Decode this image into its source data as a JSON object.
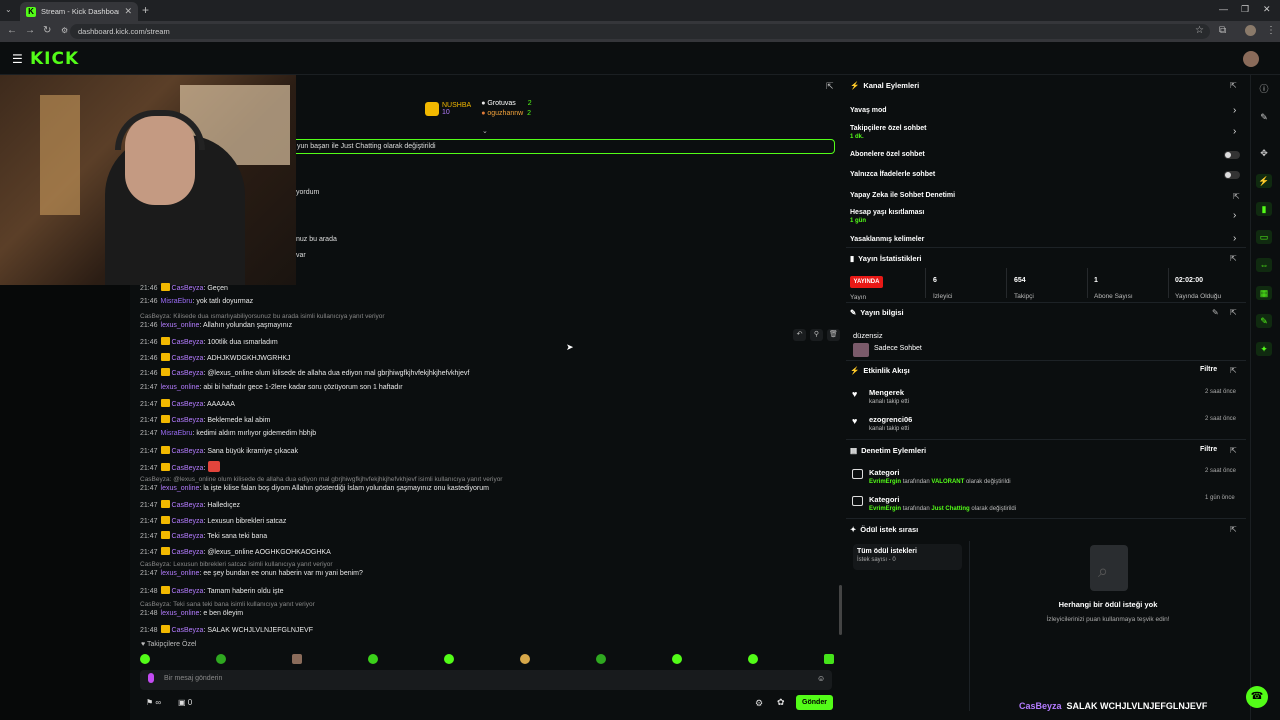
{
  "browser": {
    "tab_title": "Stream - Kick Dashboard",
    "url": "dashboard.kick.com/stream"
  },
  "header": {
    "logo": "KICK"
  },
  "leaderboard": {
    "first": {
      "name": "NUSHBA",
      "value": "10"
    },
    "second": {
      "name": "Grotuvas",
      "value": "2"
    },
    "third": {
      "name": "oguzhannw",
      "value": "2"
    }
  },
  "pinned_text": "yun başarı ile Just Chatting olarak değiştirildi",
  "ghost_lines": [
    "yordum",
    "nuz bu arada",
    "var"
  ],
  "messages": [
    {
      "time": "21:46",
      "user": "CasBeyza",
      "text": ": Geçen",
      "badge": true
    },
    {
      "time": "21:46",
      "user": "MisraEbru",
      "text": ": yok tatlı doyurmaz",
      "badge": false
    },
    {
      "reply": "CasBeyza: Kilisede dua ısmarlıyabiliyorsunuz bu arada isimli kullanıcıya yanıt veriyor"
    },
    {
      "time": "21:46",
      "user": "lexus_online",
      "text": ": Allahın yolundan şaşmayınız",
      "badge": false
    },
    {
      "time": "21:46",
      "user": "CasBeyza",
      "text": ": 100tlik dua ısmarladım",
      "badge": true
    },
    {
      "time": "21:46",
      "user": "CasBeyza",
      "text": ": ADHJKWDGKHJWGRHKJ",
      "badge": true
    },
    {
      "time": "21:46",
      "user": "CasBeyza",
      "text": ": @lexus_online olum kilisede de allaha dua ediyon mal gbrjhiwgfkjhvfekjhkjhefvkhjevf",
      "badge": true
    },
    {
      "time": "21:47",
      "user": "lexus_online",
      "text": ": abi bi haftadır gece 1-2lere kadar soru çözüyorum son 1 haftadır",
      "badge": false
    },
    {
      "time": "21:47",
      "user": "CasBeyza",
      "text": ": AAAAAA",
      "badge": true
    },
    {
      "time": "21:47",
      "user": "CasBeyza",
      "text": ": Beklemede kal abim",
      "badge": true
    },
    {
      "time": "21:47",
      "user": "MisraEbru",
      "text": ": kedimi aldım mırlıyor gidemedim hbhjb",
      "badge": false
    },
    {
      "time": "21:47",
      "user": "CasBeyza",
      "text": ": Sana büyük ikramiye çıkacak",
      "badge": true
    },
    {
      "time": "21:47",
      "user": "CasBeyza",
      "text": ":",
      "badge": true
    },
    {
      "reply": "CasBeyza: @lexus_online olum kilisede de allaha dua ediyon mal gbrjhiwgfkjhvfekjhkjhefvkhjevf isimli kullanıcıya yanıt veriyor"
    },
    {
      "time": "21:47",
      "user": "lexus_online",
      "text": ": la işte kilise falan boş diyom Allahın gösterdiği İslam yolundan şaşmayınız onu kastediyorum",
      "badge": false
    },
    {
      "time": "21:47",
      "user": "CasBeyza",
      "text": ": Halledıçez",
      "badge": true
    },
    {
      "time": "21:47",
      "user": "CasBeyza",
      "text": ": Lexusun bibrekleri satcaz",
      "badge": true
    },
    {
      "time": "21:47",
      "user": "CasBeyza",
      "text": ": Teki sana teki bana",
      "badge": true
    },
    {
      "time": "21:47",
      "user": "CasBeyza",
      "text": ": @lexus_online AOGHKGOHKAOGHKA",
      "badge": true
    },
    {
      "reply": "CasBeyza: Lexusun bibrekleri satcaz isimli kullanıcıya yanıt veriyor"
    },
    {
      "time": "21:47",
      "user": "lexus_online",
      "text": ": ee şey bundan ee onun haberin var mı yani benim?",
      "badge": false
    },
    {
      "time": "21:48",
      "user": "CasBeyza",
      "text": ": Tamam haberin oldu işte",
      "badge": true
    },
    {
      "reply": "CasBeyza: Teki sana teki bana isimli kullanıcıya yanıt veriyor"
    },
    {
      "time": "21:48",
      "user": "lexus_online",
      "text": ": e ben öleyim",
      "badge": false
    },
    {
      "time": "21:48",
      "user": "CasBeyza",
      "text": ": SALAK WCHJLVLNJEFGLNJEVF",
      "badge": true
    }
  ],
  "chat": {
    "sub_only_label": "Takipçilere Özel",
    "input_placeholder": "Bir mesaj gönderin",
    "inf_count": "∞",
    "points": "0",
    "send_label": "Gönder"
  },
  "channel_actions": {
    "title": "Kanal Eylemleri",
    "slow_mode": "Yavaş mod",
    "followers_only": "Takipçilere özel sohbet",
    "followers_only_value": "1 dk.",
    "subs_only": "Abonelere özel sohbet",
    "emote_only": "Yalnızca İfadelerle sohbet",
    "ai_mod": "Yapay Zeka ile Sohbet Denetimi",
    "age_limit": "Hesap yaşı kısıtlaması",
    "age_limit_value": "1 gün",
    "banned_words": "Yasaklanmış kelimeler"
  },
  "stats": {
    "title": "Yayın İstatistikleri",
    "live": "YAYINDA",
    "live_sub": "Yayın",
    "viewers": "6",
    "viewers_label": "İzleyici",
    "followers": "654",
    "followers_label": "Takipçi",
    "subs": "1",
    "subs_label": "Abone Sayısı",
    "duration": "02:02:00",
    "duration_label": "Yayında Olduğu"
  },
  "stream_info": {
    "title": "Yayın bilgisi",
    "stream_title": "düzensiz",
    "category": "Sadece Sohbet"
  },
  "activity": {
    "title": "Etkinlik Akışı",
    "filter": "Filtre",
    "items": [
      {
        "name": "Mengerek",
        "action": "kanalı takip etti",
        "ago": "2 saat önce"
      },
      {
        "name": "ezogrenci06",
        "action": "kanalı takip etti",
        "ago": "2 saat önce"
      }
    ]
  },
  "moderation": {
    "title": "Denetim Eylemleri",
    "filter": "Filtre",
    "items": [
      {
        "label": "Kategori",
        "by": "EvrimErgin",
        "mid": "tarafından",
        "value": "VALORANT",
        "tail": "olarak değiştirildi",
        "ago": "2 saat önce"
      },
      {
        "label": "Kategori",
        "by": "EvrimErgin",
        "mid": "tarafından",
        "value": "Just Chatting",
        "tail": "olarak değiştirildi",
        "ago": "1 gün önce"
      }
    ]
  },
  "rewards": {
    "title": "Ödül istek sırası",
    "all": "Tüm ödül istekleri",
    "count": "İstek sayısı - 0",
    "empty_title": "Herhangi bir ödül isteği yok",
    "empty_sub": "İzleyicilerinizi puan kullanmaya teşvik edin!"
  },
  "overlay": {
    "name": "CasBeyza",
    "message": "SALAK WCHJLVLNJEFGLNJEVF"
  },
  "colors": {
    "accent": "#53fc18",
    "live": "#e91916",
    "username": "#b47cff",
    "badge": "#f2b800"
  }
}
